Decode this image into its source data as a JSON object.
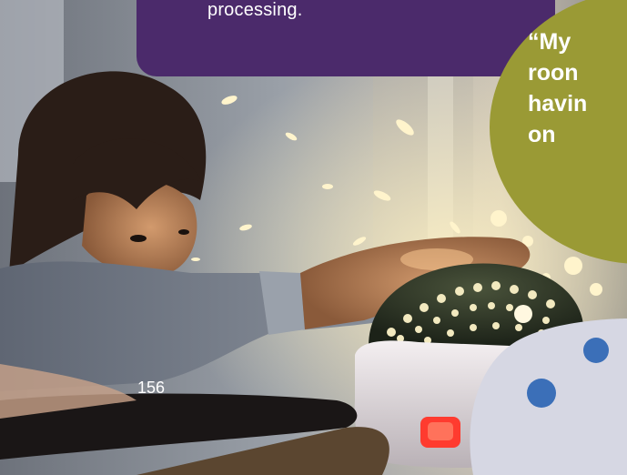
{
  "intro_text": "processing.",
  "quote_lines": [
    "“My",
    "roon",
    "havin",
    "on"
  ],
  "page_number": "156",
  "photo": {
    "subject": "child-reaching-for-star-projector-night-light",
    "palette": {
      "wall": "#8a8f98",
      "skin": "#b07a52",
      "hair": "#2a1d17",
      "sweater": "#6f7784",
      "lamp_dome": "#2b3324",
      "lamp_light": "#f2e9bf",
      "lamp_base": "#e8e3e6",
      "lamp_button": "#ff3b2f",
      "table": "#5b4630"
    }
  },
  "colors": {
    "purple_panel": "#4b2a6b",
    "olive_bubble": "#9a9a35",
    "text": "#ffffff"
  }
}
